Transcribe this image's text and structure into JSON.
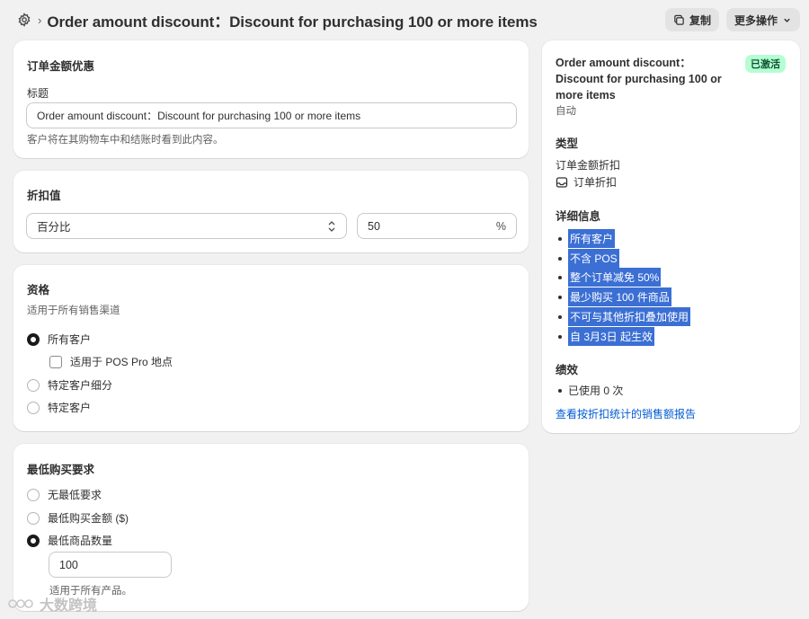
{
  "header": {
    "title": "Order amount discount：Discount for purchasing 100 or more items",
    "copy_label": "复制",
    "more_actions_label": "更多操作"
  },
  "card_title": {
    "heading": "订单金额优惠",
    "field_label": "标题",
    "field_value": "Order amount discount：Discount for purchasing 100 or more items",
    "help_text": "客户将在其购物车中和结账时看到此内容。"
  },
  "card_value": {
    "heading": "折扣值",
    "type_selected": "百分比",
    "amount": "50",
    "suffix": "%"
  },
  "card_eligibility": {
    "heading": "资格",
    "subtext": "适用于所有销售渠道",
    "options": [
      "所有客户",
      "特定客户细分",
      "特定客户"
    ],
    "selected_index": 0,
    "pos_checkbox_label": "适用于 POS Pro 地点",
    "pos_checked": false
  },
  "card_min": {
    "heading": "最低购买要求",
    "options": [
      "无最低要求",
      "最低购买金额 ($)",
      "最低商品数量"
    ],
    "selected_index": 2,
    "quantity_value": "100",
    "help_text": "适用于所有产品。"
  },
  "summary": {
    "title": "Order amount discount：Discount for purchasing 100 or more items",
    "status_badge": "已激活",
    "method": "自动",
    "type_heading": "类型",
    "type_value": "订单金额折扣",
    "type_sub": "订单折扣",
    "details_heading": "详细信息",
    "details": [
      "所有客户",
      "不含 POS",
      "整个订单减免 50%",
      "最少购买 100 件商品",
      "不可与其他折扣叠加使用",
      "自 3月3日 起生效"
    ],
    "performance_heading": "绩效",
    "usage": "已使用 0 次",
    "report_link": "查看按折扣统计的销售额报告"
  },
  "watermark": "大数跨境",
  "colors": {
    "background": "#f1f1f1",
    "badge_bg": "#b4fed2",
    "badge_text": "#0c5132",
    "selection": "#3b6fd4",
    "link": "#005bd3"
  }
}
